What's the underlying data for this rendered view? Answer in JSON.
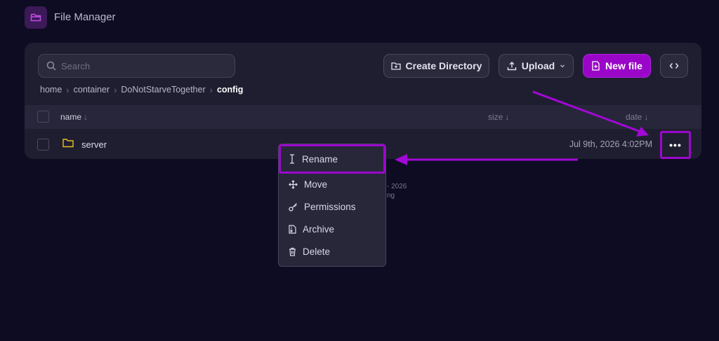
{
  "app": {
    "title": "File Manager",
    "icon": "folder-icon",
    "accent_color": "#9a06c8"
  },
  "search": {
    "placeholder": "Search",
    "value": ""
  },
  "toolbar": {
    "create_directory_label": "Create Directory",
    "upload_label": "Upload",
    "new_file_label": "New file",
    "code_toggle_label": "<>"
  },
  "breadcrumb": [
    {
      "label": "home"
    },
    {
      "label": "container"
    },
    {
      "label": "DoNotStarveTogether"
    },
    {
      "label": "config",
      "current": true
    }
  ],
  "table": {
    "columns": [
      {
        "label": "name",
        "sort": "↓"
      },
      {
        "label": "size",
        "sort": "↓"
      },
      {
        "label": "date",
        "sort": "↓"
      }
    ],
    "rows": [
      {
        "name": "server",
        "type": "folder",
        "size": "",
        "date": "Jul 9th, 2026 4:02PM",
        "actions_label": "•••"
      }
    ]
  },
  "background_text": {
    "line1": "- 2026",
    "line2": "ng"
  },
  "context_menu": {
    "items": [
      {
        "label": "Rename",
        "icon": "text-cursor-icon",
        "highlighted": true
      },
      {
        "label": "Move",
        "icon": "move-arrows-icon"
      },
      {
        "label": "Permissions",
        "icon": "key-icon"
      },
      {
        "label": "Archive",
        "icon": "archive-file-icon"
      },
      {
        "label": "Delete",
        "icon": "trash-icon"
      }
    ]
  },
  "annotation_color": "#a308d6"
}
